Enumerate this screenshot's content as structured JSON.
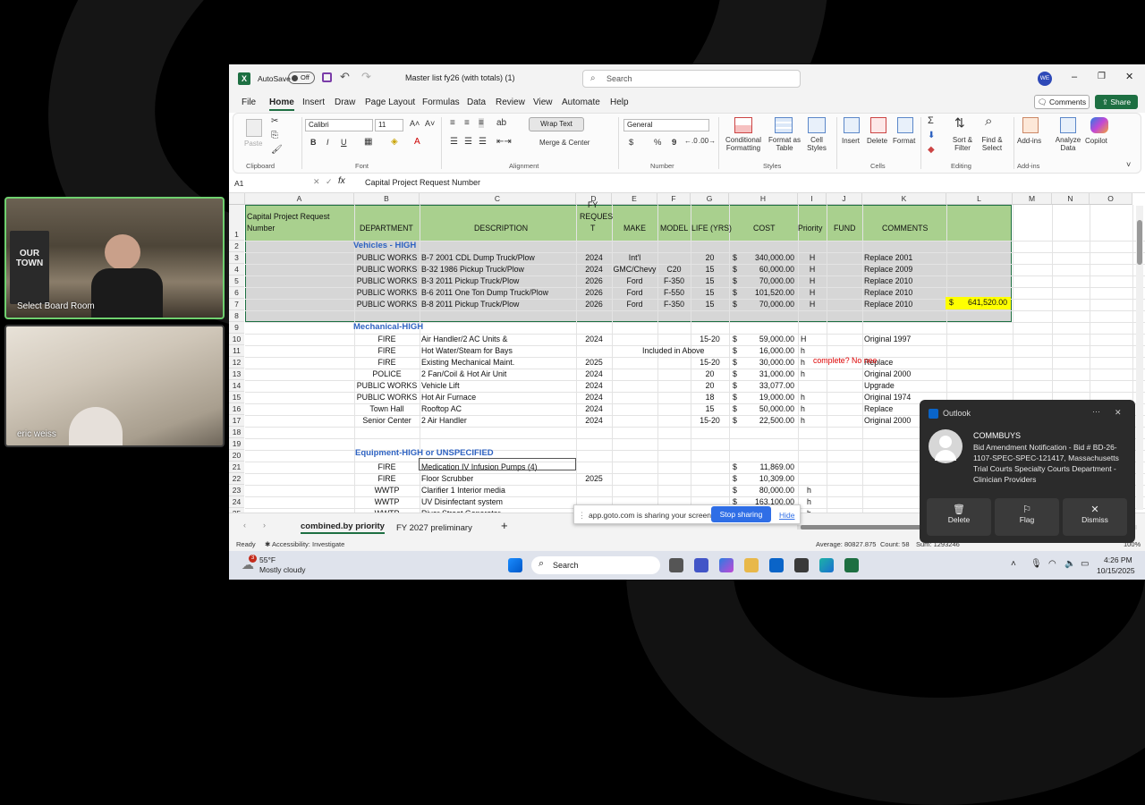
{
  "participants": [
    {
      "name": "Select Board Room",
      "sign": "OUR TOWN"
    },
    {
      "name": "eric weiss"
    }
  ],
  "excel": {
    "autosave": "AutoSave",
    "autosave_state": "Off",
    "file_title": "Master list fy26 (with totals) (1)",
    "search_placeholder": "Search",
    "user_initials": "WE",
    "tabs": [
      "File",
      "Home",
      "Insert",
      "Draw",
      "Page Layout",
      "Formulas",
      "Data",
      "Review",
      "View",
      "Automate",
      "Help"
    ],
    "comments": "Comments",
    "share": "Share",
    "ribbon": {
      "paste": "Paste",
      "clipboard": "Clipboard",
      "font_name": "Calibri",
      "font_size": "11",
      "font": "Font",
      "wrap": "Wrap Text",
      "merge": "Merge & Center",
      "alignment": "Alignment",
      "numfmt": "General",
      "number": "Number",
      "cond": "Conditional Formatting",
      "fmt_table": "Format as Table",
      "cell_styles": "Cell Styles",
      "styles": "Styles",
      "insert": "Insert",
      "delete": "Delete",
      "format": "Format",
      "cells": "Cells",
      "sort": "Sort & Filter",
      "find": "Find & Select",
      "editing": "Editing",
      "addins": "Add-ins",
      "analyze": "Analyze Data",
      "copilot": "Copilot",
      "addins_grp": "Add-ins",
      "bold": "B",
      "italic": "I",
      "underline": "U",
      "dollar": "$",
      "percent": "%",
      "comma": "9"
    },
    "namebox": "A1",
    "formula": "Capital Project Request Number",
    "columns": [
      "A",
      "B",
      "C",
      "D",
      "E",
      "F",
      "G",
      "H",
      "I",
      "J",
      "K",
      "L",
      "M",
      "N",
      "O"
    ],
    "header": {
      "a": "Capital Project Request",
      "a2": "Number",
      "b": "DEPARTMENT",
      "c": "DESCRIPTION",
      "d1": "FY",
      "d2": "REQUES",
      "d3": "T",
      "e": "MAKE",
      "f": "MODEL",
      "g": "LIFE (YRS)",
      "h": "COST",
      "i": "Priority",
      "j": "FUND",
      "k": "COMMENTS"
    },
    "sections": {
      "vehicles": "Vehicles - HIGH",
      "mechanical": "Mechanical-HIGH",
      "equipment": "Equipment-HIGH or UNSPECIFIED"
    },
    "rows": [
      {
        "r": "3",
        "b": "PUBLIC WORKS",
        "c": "B-7  2001 CDL Dump Truck/Plow",
        "d": "2024",
        "e": "Int'l",
        "f": "",
        "g": "20",
        "h": "340,000.00",
        "i": "H",
        "k": "Replace 2001"
      },
      {
        "r": "4",
        "b": "PUBLIC WORKS",
        "c": "B-32  1986 Pickup Truck/Plow",
        "d": "2024",
        "e": "GMC/Chevy",
        "f": "C20",
        "g": "15",
        "h": "60,000.00",
        "i": "H",
        "k": "Replace 2009"
      },
      {
        "r": "5",
        "b": "PUBLIC WORKS",
        "c": "B-3  2011 Pickup Truck/Plow",
        "d": "2026",
        "e": "Ford",
        "f": "F-350",
        "g": "15",
        "h": "70,000.00",
        "i": "H",
        "k": "Replace 2010"
      },
      {
        "r": "6",
        "b": "PUBLIC WORKS",
        "c": "B-6  2011 One Ton Dump Truck/Plow",
        "d": "2026",
        "e": "Ford",
        "f": "F-550",
        "g": "15",
        "h": "101,520.00",
        "i": "H",
        "k": "Replace 2010"
      },
      {
        "r": "7",
        "b": "PUBLIC WORKS",
        "c": "B-8  2011 Pickup Truck/Plow",
        "d": "2026",
        "e": "Ford",
        "f": "F-350",
        "g": "15",
        "h": "70,000.00",
        "i": "H",
        "k": "Replace 2010"
      },
      {
        "r": "10",
        "b": "FIRE",
        "c": "Air Handler/2 AC Units &",
        "d": "2024",
        "e": "",
        "f": "",
        "g": "15-20",
        "h": "59,000.00",
        "i": "H",
        "k": "Original 1997"
      },
      {
        "r": "11",
        "b": "FIRE",
        "c": "Hot Water/Steam for Bays",
        "d": "",
        "e": "Included in Above",
        "f": "",
        "g": "",
        "h": "16,000.00",
        "i": "h",
        "k": ""
      },
      {
        "r": "12",
        "b": "FIRE",
        "c": "Existing Mechanical Maint.",
        "d": "2025",
        "e": "",
        "f": "",
        "g": "15-20",
        "h": "30,000.00",
        "i": "h",
        "k": "Replace"
      },
      {
        "r": "13",
        "b": "POLICE",
        "c": "2 Fan/Coil & Hot Air Unit",
        "d": "2024",
        "e": "",
        "f": "",
        "g": "20",
        "h": "31,000.00",
        "i": "h",
        "k": "Original 2000"
      },
      {
        "r": "14",
        "b": "PUBLIC WORKS",
        "c": "Vehicle Lift",
        "d": "2024",
        "e": "",
        "f": "",
        "g": "20",
        "h": "33,077.00",
        "i": "",
        "k": "Upgrade"
      },
      {
        "r": "15",
        "b": "PUBLIC WORKS",
        "c": "Hot Air Furnace",
        "d": "2024",
        "e": "",
        "f": "",
        "g": "18",
        "h": "19,000.00",
        "i": "h",
        "k": "Original 1974"
      },
      {
        "r": "16",
        "b": "Town Hall",
        "c": "Rooftop AC",
        "d": "2024",
        "e": "",
        "f": "",
        "g": "15",
        "h": "50,000.00",
        "i": "h",
        "k": "Replace"
      },
      {
        "r": "17",
        "b": "Senior Center",
        "c": "2 Air Handler",
        "d": "2024",
        "e": "",
        "f": "",
        "g": "15-20",
        "h": "22,500.00",
        "i": "h",
        "k": "Original 2000"
      },
      {
        "r": "21",
        "b": "FIRE",
        "c": "Medication IV Infusion Pumps (4)",
        "d": "",
        "e": "",
        "f": "",
        "g": "",
        "h": "11,869.00",
        "i": "",
        "k": ""
      },
      {
        "r": "22",
        "b": "FIRE",
        "c": "Floor Scrubber",
        "d": "2025",
        "e": "",
        "f": "",
        "g": "",
        "h": "10,309.00",
        "i": "",
        "k": ""
      },
      {
        "r": "23",
        "b": "WWTP",
        "c": "Clarifier 1 Interior media",
        "d": "",
        "e": "",
        "f": "",
        "g": "",
        "h": "80,000.00",
        "i": "h",
        "k": ""
      },
      {
        "r": "24",
        "b": "WWTP",
        "c": "UV Disinfectant system",
        "d": "",
        "e": "",
        "f": "",
        "g": "",
        "h": "163,100.00",
        "i": "h",
        "k": ""
      },
      {
        "r": "25",
        "b": "WWTP",
        "c": "River Street Generator",
        "d": "",
        "e": "",
        "f": "",
        "g": "",
        "h": "",
        "i": "h",
        "k": ""
      }
    ],
    "row_numbers": [
      "1",
      "2",
      "3",
      "4",
      "5",
      "6",
      "7",
      "8",
      "9",
      "10",
      "11",
      "12",
      "13",
      "14",
      "15",
      "16",
      "17",
      "18",
      "19",
      "20",
      "21",
      "22",
      "23",
      "24",
      "25"
    ],
    "red_note": "complete? No nee",
    "total": "641,520.00",
    "currency": "$",
    "sheet_tabs": [
      "combined.by priority",
      "FY 2027 preliminary"
    ],
    "status": {
      "ready": "Ready",
      "access": "Accessibility: Investigate",
      "average": "Average: 80827.875",
      "count": "Count: 58",
      "sum": "Sum: 1293246",
      "zoom": "100%"
    }
  },
  "share_bar": {
    "text": "app.goto.com is sharing your screen.",
    "stop": "Stop sharing",
    "hide": "Hide"
  },
  "toast": {
    "app": "Outlook",
    "sender": "COMMBUYS",
    "body": "Bid Amendment Notification - Bid # BD-26-1107-SPEC-SPEC-121417, Massachusetts Trial Courts Specialty Courts Department -Clinician Providers",
    "delete": "Delete",
    "flag": "Flag",
    "dismiss": "Dismiss",
    "more": "···"
  },
  "taskbar": {
    "temp": "55°F",
    "weather": "Mostly cloudy",
    "badge": "3",
    "search": "Search",
    "time": "4:26 PM",
    "date": "10/15/2025"
  }
}
